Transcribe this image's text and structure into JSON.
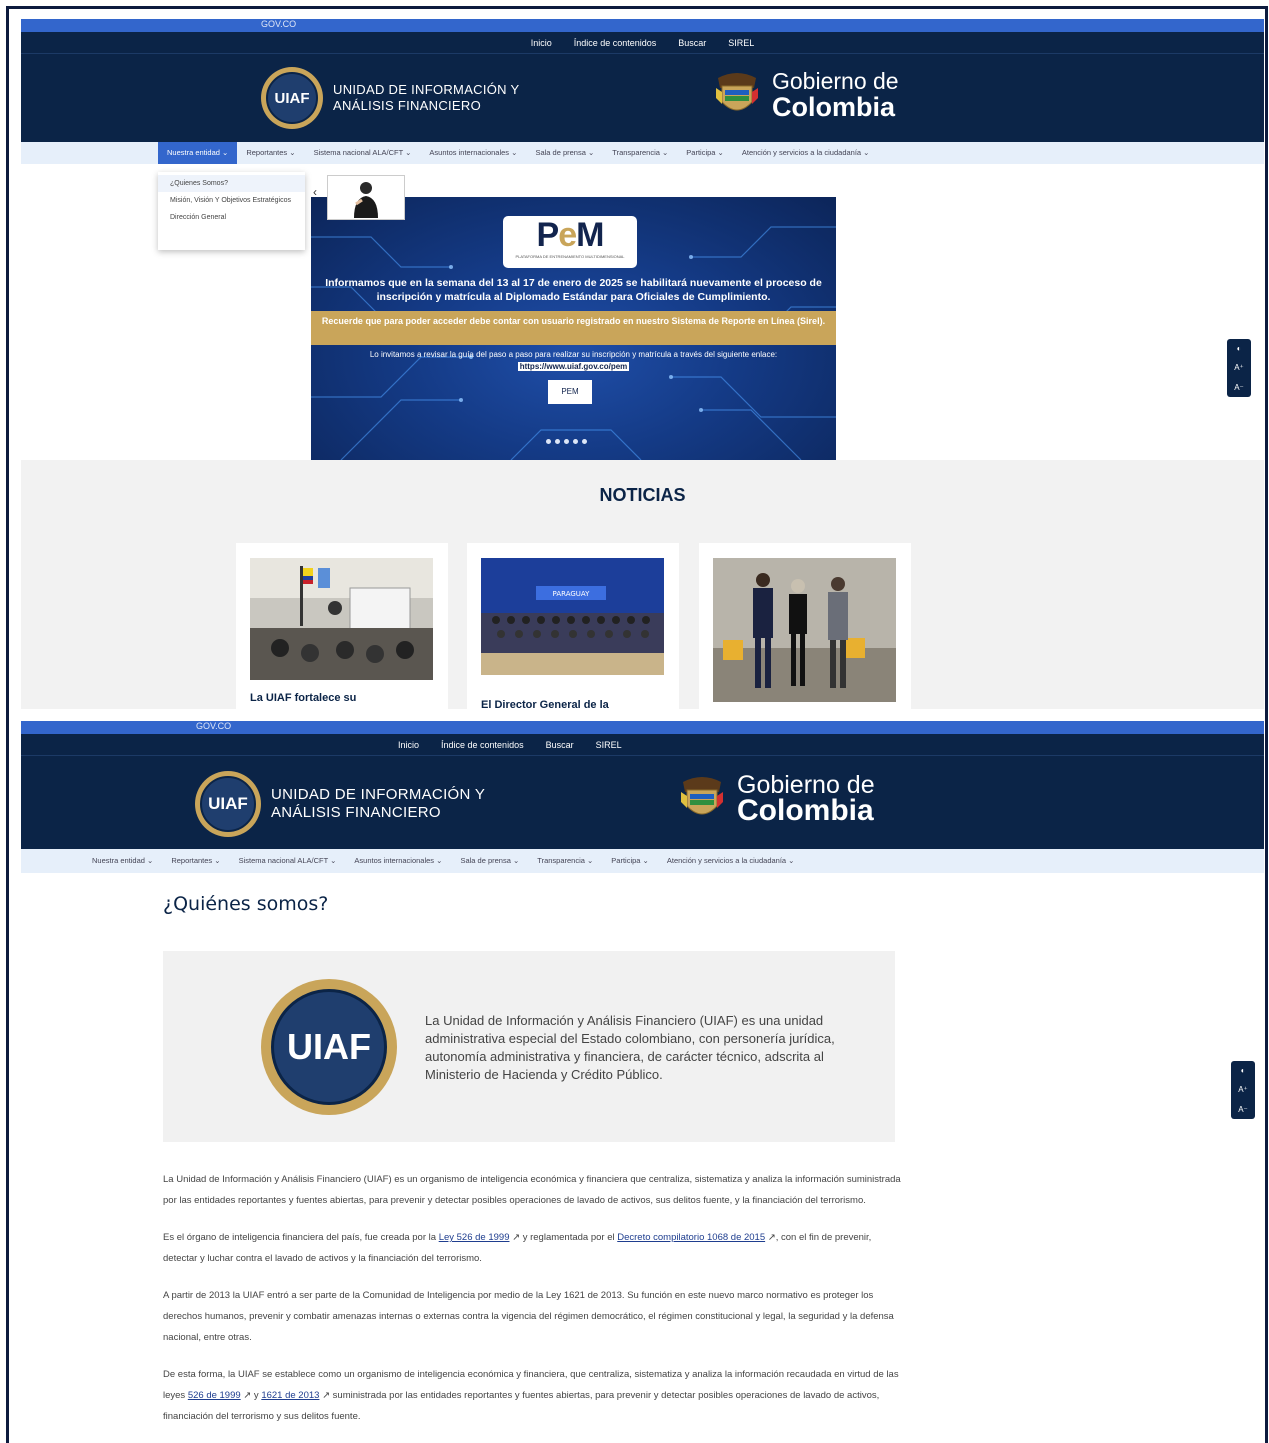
{
  "gov_bar": {
    "label": "GOV.CO"
  },
  "top_nav": [
    "Inicio",
    "Índice de contenidos",
    "Buscar",
    "SIREL"
  ],
  "uiaf": {
    "badge": "UIAF",
    "name_line1": "UNIDAD DE INFORMACIÓN Y",
    "name_line2": "ANÁLISIS FINANCIERO"
  },
  "gobierno": {
    "line1": "Gobierno de",
    "line2": "Colombia"
  },
  "main_nav": [
    "Nuestra entidad ⌄",
    "Reportantes ⌄",
    "Sistema nacional ALA/CFT ⌄",
    "Asuntos internacionales ⌄",
    "Sala de prensa ⌄",
    "Transparencia ⌄",
    "Participa ⌄",
    "Atención y servicios a la ciudadanía ⌄"
  ],
  "dropdown": [
    "¿Quienes Somos?",
    "Misión, Visión Y Objetivos Estratégicos",
    "Dirección General"
  ],
  "banner": {
    "logo": "PEM",
    "logo_sub": "PLATAFORMA DE ENTRENAMIENTO MULTIDIMENSIONAL",
    "headline": "Informamos que en la semana del 13 al 17 de enero de 2025 se habilitará nuevamente el proceso de inscripción y matrícula al Diplomado Estándar para Oficiales de Cumplimiento.",
    "notice": "Recuerde que para poder acceder debe contar con usuario registrado en nuestro Sistema de Reporte en Línea (Sirel).",
    "invite": "Lo invitamos a revisar la guía del paso a paso para realizar su inscripción y matrícula a través del siguiente enlace:",
    "link": "https://www.uiaf.gov.co/pem",
    "button": "PEM"
  },
  "news": {
    "title": "NOTICIAS",
    "cards": [
      {
        "caption": "La UIAF fortalece su"
      },
      {
        "caption": "El Director General de la"
      },
      {
        "caption": ""
      }
    ]
  },
  "a11y": {
    "contrast": "◐",
    "font_up": "A⁺",
    "font_down": "A⁻"
  },
  "page": {
    "title": "¿Quiénes somos?",
    "badge": "UIAF",
    "intro": "La Unidad de Información y Análisis Financiero (UIAF) es una unidad administrativa especial del Estado colombiano, con personería jurídica, autonomía administrativa y financiera, de carácter técnico, adscrita al Ministerio de Hacienda y Crédito Público.",
    "p1": "La Unidad de Información y Análisis Financiero (UIAF) es un organismo de inteligencia económica y financiera que centraliza, sistematiza y analiza la información suministrada por las entidades reportantes y fuentes abiertas, para prevenir y detectar posibles operaciones de lavado de activos, sus delitos fuente, y la financiación del terrorismo.",
    "p2_a": "Es el órgano de inteligencia financiera del país, fue creada por la ",
    "p2_link1": "Ley 526 de 1999",
    "p2_b": " ↗ y reglamentada por el ",
    "p2_link2": "Decreto compilatorio 1068 de 2015",
    "p2_c": " ↗, con el fin de prevenir, detectar y luchar contra el lavado de activos y la financiación del terrorismo.",
    "p3": "A partir de 2013 la UIAF entró a ser parte de la Comunidad de Inteligencia por medio de la Ley 1621 de 2013. Su función en este nuevo marco normativo es proteger los derechos humanos, prevenir y combatir amenazas internas o externas contra la vigencia del régimen democrático, el régimen constitucional y legal, la seguridad y la defensa nacional, entre otras.",
    "p4_a": "De esta forma, la UIAF se establece como un organismo de inteligencia económica y financiera, que centraliza, sistematiza y analiza la información recaudada en virtud de las leyes ",
    "p4_link1": "526 de 1999",
    "p4_b": " ↗ y ",
    "p4_link2": "1621 de 2013",
    "p4_c": " ↗ suministrada por las entidades reportantes y fuentes abiertas, para prevenir y detectar posibles operaciones de lavado de activos, financiación del terrorismo y sus delitos fuente."
  }
}
